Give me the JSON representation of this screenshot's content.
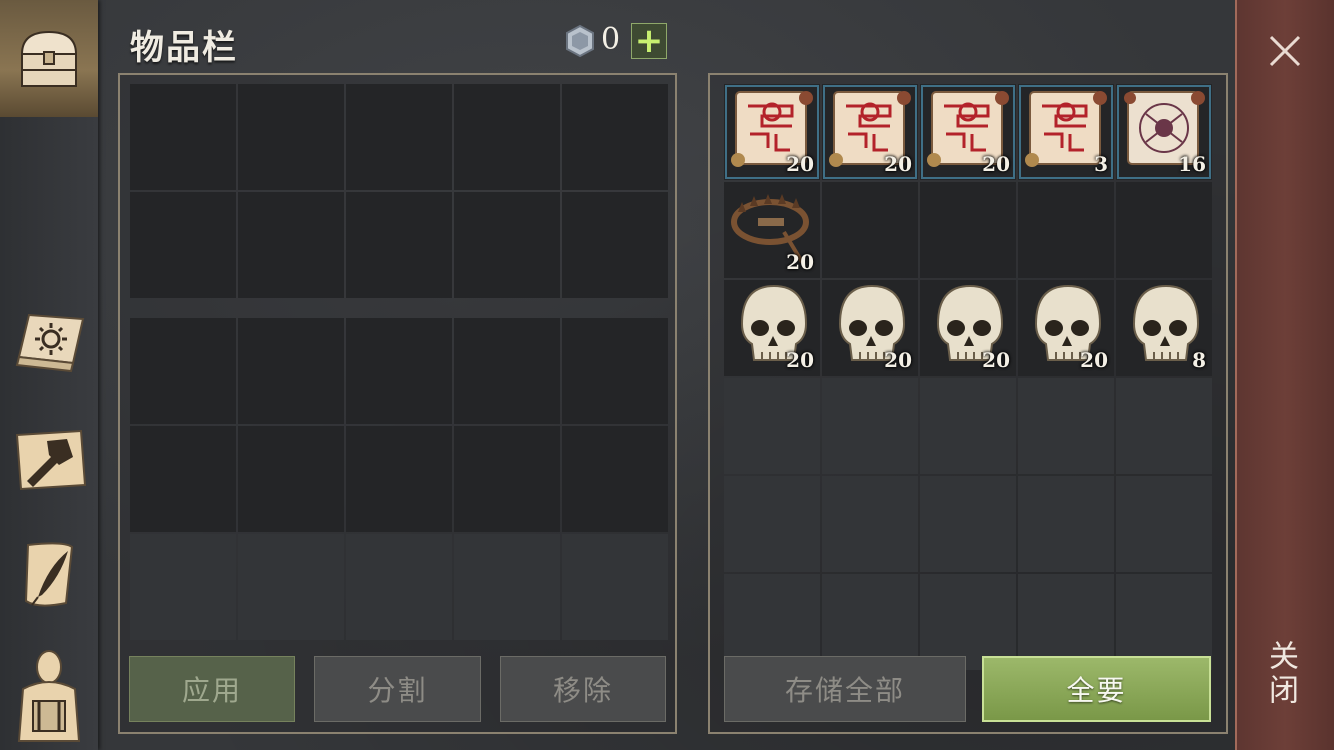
{
  "title": "物品栏",
  "currency": {
    "count": "0",
    "add_label": "+"
  },
  "buttons": {
    "apply": "应用",
    "split": "分割",
    "remove": "移除",
    "store_all": "存储全部",
    "take_all": "全要"
  },
  "close_label": "关闭",
  "nav_icons": [
    "chest-icon",
    "sun-book-icon",
    "hammer-map-icon",
    "quill-scroll-icon",
    "backpack-icon"
  ],
  "storage_items": [
    {
      "type": "red-rune-scroll",
      "qty": "20"
    },
    {
      "type": "red-rune-scroll",
      "qty": "20"
    },
    {
      "type": "red-rune-scroll",
      "qty": "20"
    },
    {
      "type": "red-rune-scroll",
      "qty": "3"
    },
    {
      "type": "skull-rune-scroll",
      "qty": "16"
    },
    {
      "type": "bear-trap",
      "qty": "20"
    },
    {
      "type": "skull",
      "qty": "20"
    },
    {
      "type": "skull",
      "qty": "20"
    },
    {
      "type": "skull",
      "qty": "20"
    },
    {
      "type": "skull",
      "qty": "20"
    },
    {
      "type": "skull",
      "qty": "8"
    }
  ]
}
